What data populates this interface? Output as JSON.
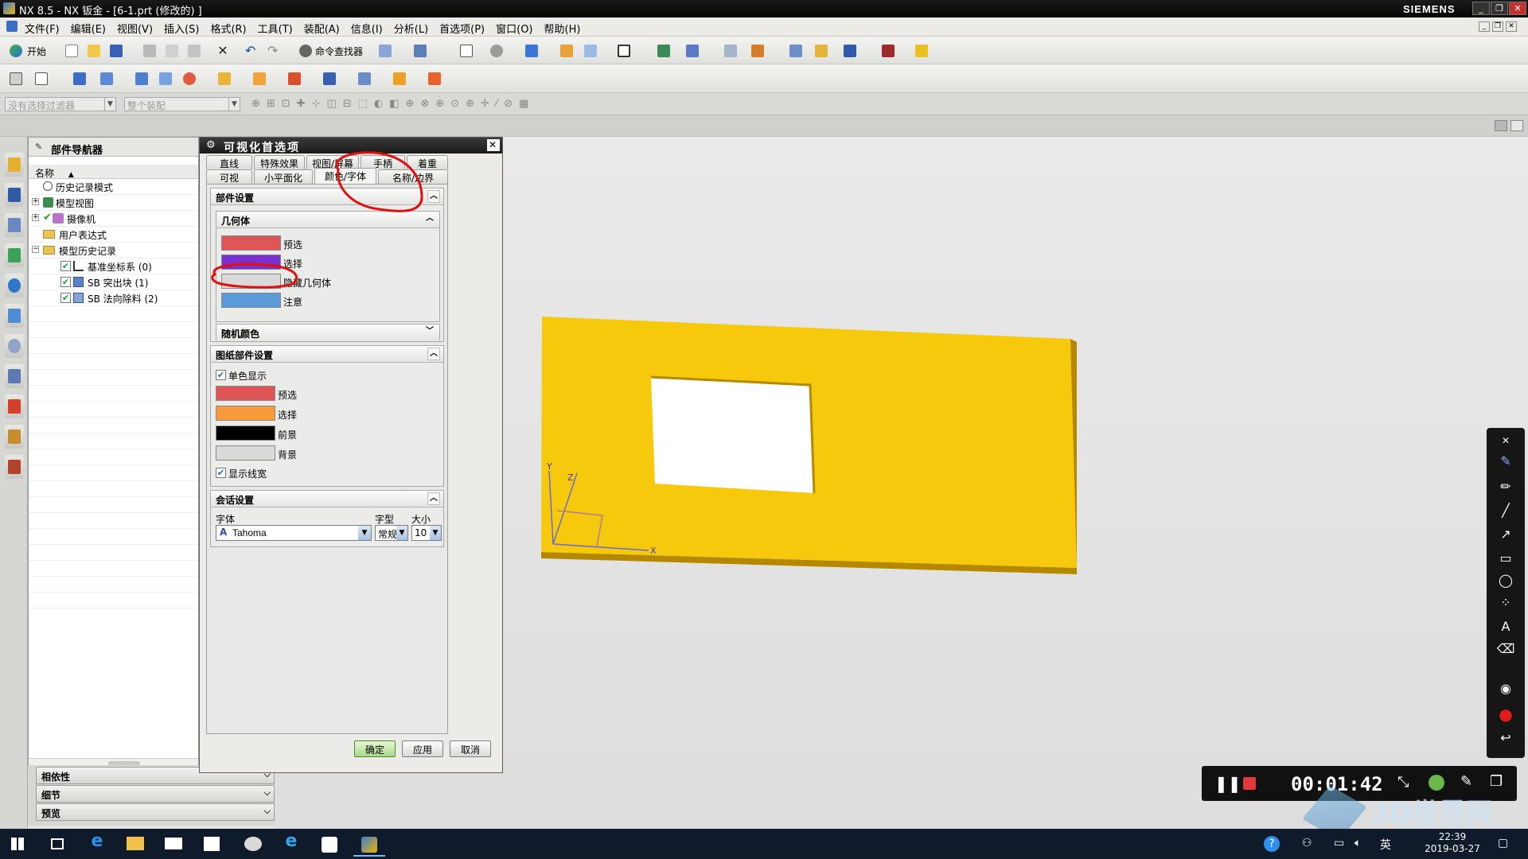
{
  "window": {
    "title": "NX 8.5 - NX 钣金 - [6-1.prt  (修改的)  ]",
    "brand": "SIEMENS"
  },
  "menu": [
    "文件(F)",
    "编辑(E)",
    "视图(V)",
    "插入(S)",
    "格式(R)",
    "工具(T)",
    "装配(A)",
    "信息(I)",
    "分析(L)",
    "首选项(P)",
    "窗口(O)",
    "帮助(H)"
  ],
  "toolbar": {
    "start_label": "开始",
    "command_finder_label": "命令查找器"
  },
  "selection_bar": {
    "filter_placeholder": "没有选择过滤器",
    "scope_placeholder": "整个装配"
  },
  "navigator": {
    "title": "部件导航器",
    "column_name": "名称",
    "items": [
      {
        "label": "历史记录模式"
      },
      {
        "label": "模型视图"
      },
      {
        "label": "摄像机"
      },
      {
        "label": "用户表达式"
      },
      {
        "label": "模型历史记录"
      },
      {
        "label": "基准坐标系 (0)"
      },
      {
        "label": "SB 突出块 (1)"
      },
      {
        "label": "SB 法向除料 (2)"
      }
    ],
    "footer": [
      "相依性",
      "细节",
      "预览"
    ]
  },
  "dialog": {
    "title": "可视化首选项",
    "tabs_row1": [
      "直线",
      "特殊效果",
      "视图/屏幕",
      "手柄",
      "着重"
    ],
    "tabs_row2": [
      "可视",
      "小平面化",
      "颜色/字体",
      "名称/边界"
    ],
    "part_settings": {
      "title": "部件设置",
      "geometry_title": "几何体",
      "swatches": [
        {
          "label": "预选",
          "color": "#e05656"
        },
        {
          "label": "选择",
          "color": "#7a2fd0"
        },
        {
          "label": "隐藏几何体",
          "color": "#d9d9d9"
        },
        {
          "label": "注意",
          "color": "#5a9ad8"
        }
      ],
      "random_color_title": "随机颜色"
    },
    "drawing_settings": {
      "title": "图纸部件设置",
      "monochrome_label": "单色显示",
      "swatches": [
        {
          "label": "预选",
          "color": "#e05656"
        },
        {
          "label": "选择",
          "color": "#f79a3c"
        },
        {
          "label": "前景",
          "color": "#000000"
        },
        {
          "label": "背景",
          "color": "#d9d9d9"
        }
      ],
      "line_width_label": "显示线宽"
    },
    "session_settings": {
      "title": "会话设置",
      "font_label": "字体",
      "style_label": "字型",
      "size_label": "大小",
      "font_value": "Tahoma",
      "style_value": "常规",
      "size_value": "10"
    },
    "buttons": {
      "ok": "确定",
      "apply": "应用",
      "cancel": "取消"
    }
  },
  "model": {
    "face_color": "#f6c90c",
    "edge_color": "#b58800",
    "hole_color": "#ffffff",
    "axis_labels": {
      "x": "X",
      "y": "Y",
      "z": "Z"
    }
  },
  "recorder": {
    "time": "00:01:42"
  },
  "taskbar": {
    "time": "22:39",
    "date": "2019-03-27",
    "ime": "英"
  },
  "watermark": {
    "main": "3D世界网",
    "sub": "WWW.3DSJW.COM"
  },
  "colors": {
    "annotation_red": "#e01010"
  }
}
